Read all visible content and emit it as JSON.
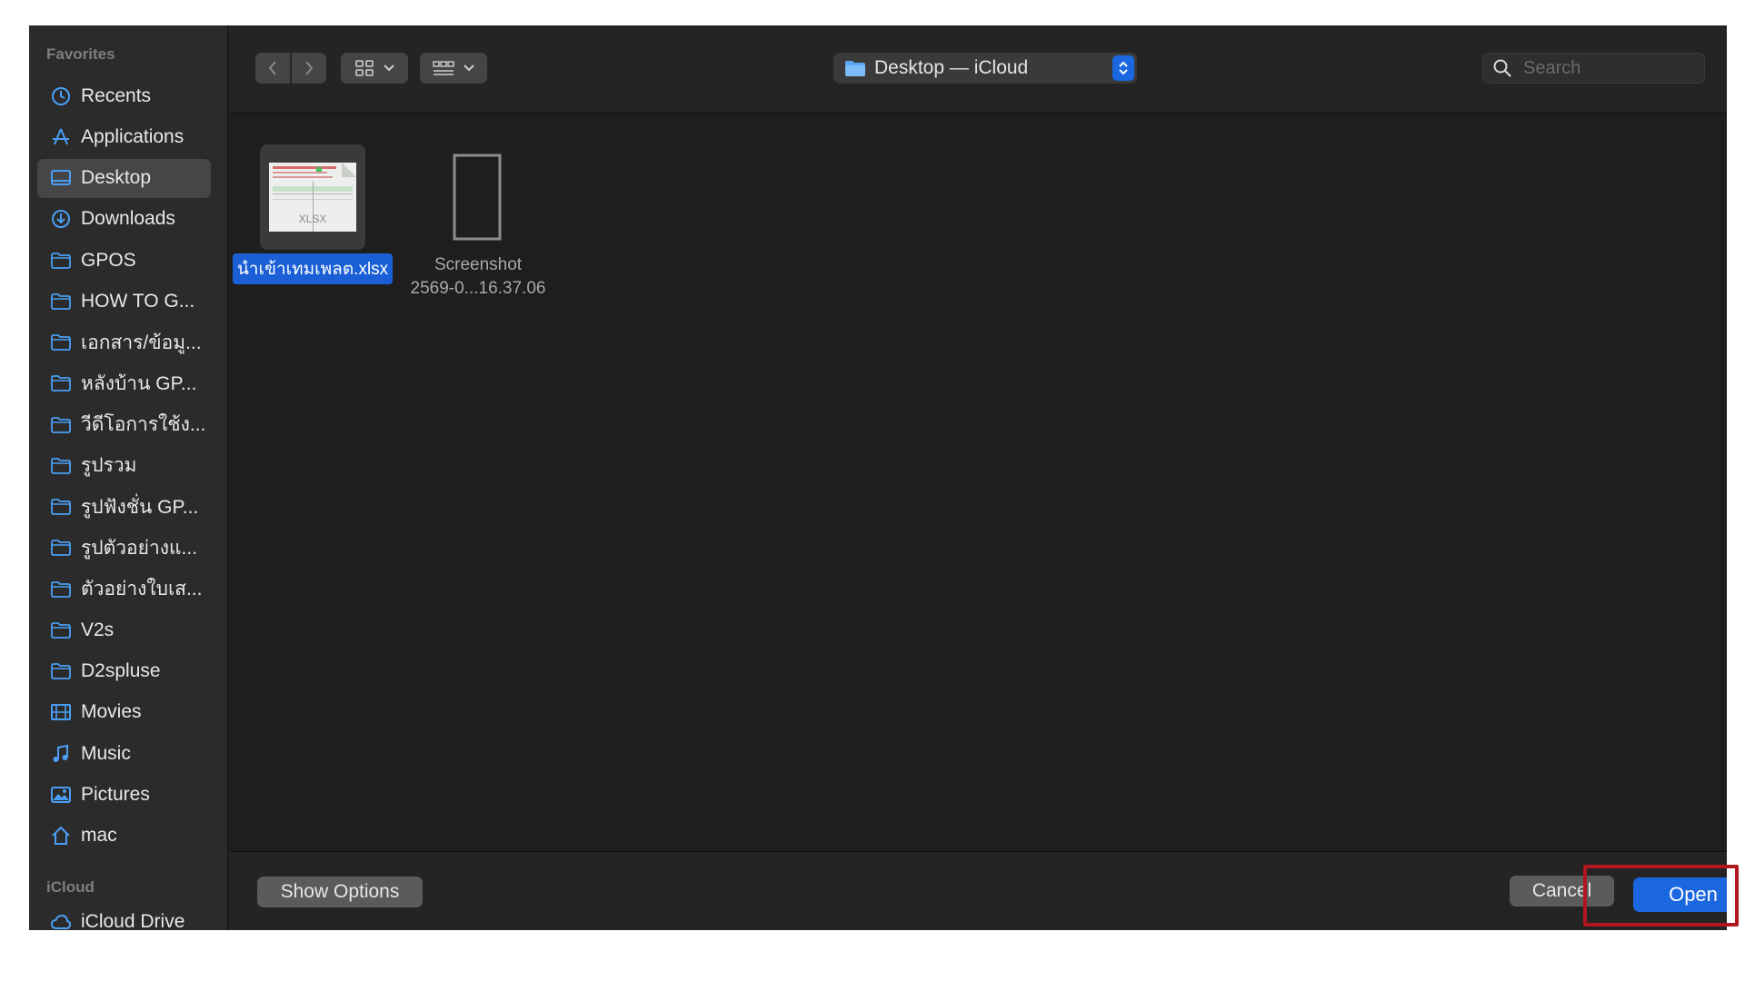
{
  "sidebar": {
    "favorites_header": "Favorites",
    "favorites": [
      {
        "label": "Recents",
        "icon": "clock-icon"
      },
      {
        "label": "Applications",
        "icon": "applications-icon"
      },
      {
        "label": "Desktop",
        "icon": "desktop-icon",
        "selected": true
      },
      {
        "label": "Downloads",
        "icon": "downloads-icon"
      },
      {
        "label": "GPOS",
        "icon": "folder-icon"
      },
      {
        "label": "HOW TO G...",
        "icon": "folder-icon"
      },
      {
        "label": "เอกสาร/ข้อมู...",
        "icon": "folder-icon"
      },
      {
        "label": "หลังบ้าน GP...",
        "icon": "folder-icon"
      },
      {
        "label": "วีดีโอการใช้ง...",
        "icon": "folder-icon"
      },
      {
        "label": "รูปรวม",
        "icon": "folder-icon"
      },
      {
        "label": "รูปฟังชั่น GP...",
        "icon": "folder-icon"
      },
      {
        "label": "รูปตัวอย่างแ...",
        "icon": "folder-icon"
      },
      {
        "label": "ตัวอย่างใบเส...",
        "icon": "folder-icon"
      },
      {
        "label": "V2s",
        "icon": "folder-icon"
      },
      {
        "label": "D2spluse",
        "icon": "folder-icon"
      },
      {
        "label": "Movies",
        "icon": "movies-icon"
      },
      {
        "label": "Music",
        "icon": "music-icon"
      },
      {
        "label": "Pictures",
        "icon": "pictures-icon"
      },
      {
        "label": "mac",
        "icon": "home-icon"
      }
    ],
    "icloud_header": "iCloud",
    "icloud": [
      {
        "label": "iCloud Drive",
        "icon": "cloud-icon"
      }
    ]
  },
  "toolbar": {
    "location": "Desktop — iCloud",
    "search_placeholder": "Search"
  },
  "files": [
    {
      "name": "นำเข้าเทมเพลต.xlsx",
      "type_label": "XLSX",
      "selected": true
    },
    {
      "name_line1": "Screenshot",
      "name_line2": "2569-0...16.37.06",
      "selected": false
    }
  ],
  "footer": {
    "show_options": "Show Options",
    "cancel": "Cancel",
    "open": "Open"
  },
  "colors": {
    "accent": "#1a67e0",
    "selection": "#1a5fd6",
    "highlight_box": "#b0171e",
    "sidebar_icon": "#4a9ff5"
  }
}
